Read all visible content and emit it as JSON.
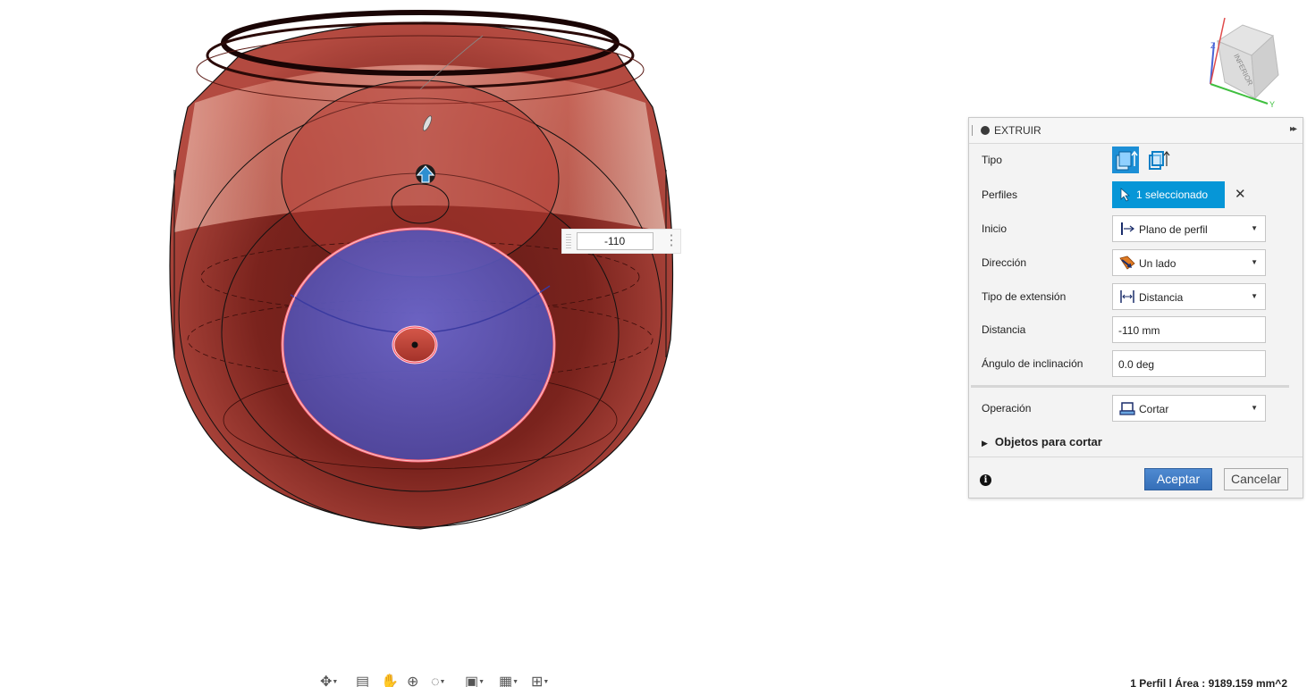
{
  "viewcube": {
    "face_label": "INFERIOR",
    "axis_z": "Z",
    "axis_y": "Y"
  },
  "dimension_input": {
    "value": "-110"
  },
  "panel": {
    "title": "EXTRUIR",
    "rows": {
      "tipo": {
        "label": "Tipo"
      },
      "perfiles": {
        "label": "Perfiles",
        "button": "1 seleccionado",
        "clear": "✕"
      },
      "inicio": {
        "label": "Inicio",
        "value": "Plano de perfil"
      },
      "direccion": {
        "label": "Dirección",
        "value": "Un lado"
      },
      "tipo_extension": {
        "label": "Tipo de extensión",
        "value": "Distancia"
      },
      "distancia": {
        "label": "Distancia",
        "value": "-110 mm"
      },
      "angulo": {
        "label": "Ángulo de inclinación",
        "value": "0.0 deg"
      },
      "operacion": {
        "label": "Operación",
        "value": "Cortar"
      }
    },
    "section": {
      "label": "Objetos para cortar"
    },
    "ok_label": "Aceptar",
    "cancel_label": "Cancelar"
  },
  "nav_toolbar": {
    "items": [
      "orbit-icon",
      "look-at-icon",
      "pan-icon",
      "zoom-icon",
      "fit-icon",
      "display-settings-icon",
      "grid-icon",
      "viewports-icon"
    ]
  },
  "status_text": "1 Perfil | Área : 9189.159 mm^2",
  "colors": {
    "accent": "#0696d7",
    "ok_button": "#3f7cc4",
    "body_red": "#8e2a22",
    "profile_blue": "#5b54b8",
    "profile_outline": "#ff5a6a"
  }
}
